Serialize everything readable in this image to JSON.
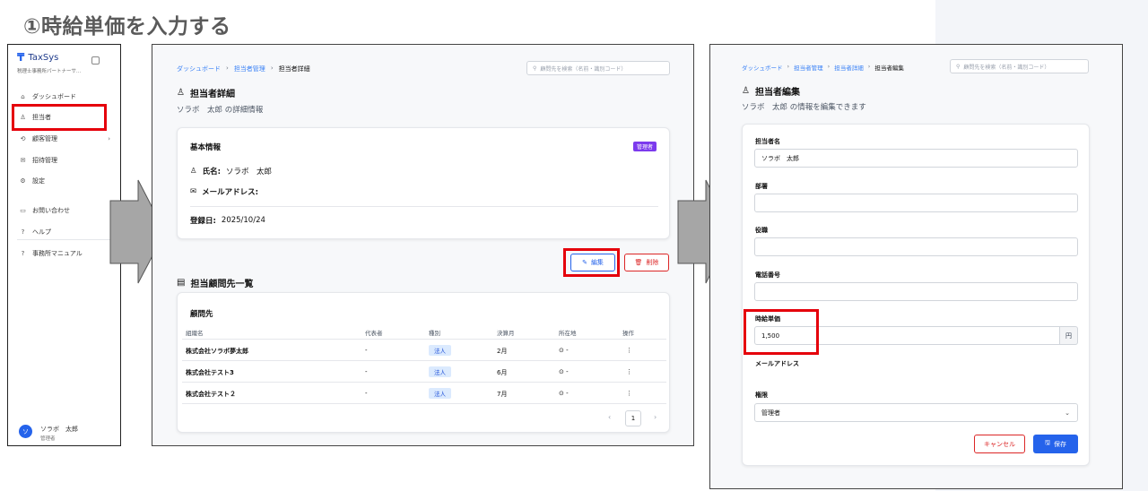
{
  "step_title": "①時給単価を入力する",
  "sidebar": {
    "app_name": "TaxSys",
    "app_sub": "税理士事務所パートナーサ…",
    "items": [
      {
        "label": "ダッシュボード",
        "icon": "home-icon"
      },
      {
        "label": "担当者",
        "icon": "user-icon"
      },
      {
        "label": "顧客管理",
        "icon": "clients-icon",
        "chevron": "›"
      },
      {
        "label": "招待管理",
        "icon": "mail-icon"
      },
      {
        "label": "設定",
        "icon": "gear-icon"
      },
      {
        "label": "お問い合わせ",
        "icon": "message-icon"
      },
      {
        "label": "ヘルプ",
        "icon": "help-icon"
      },
      {
        "label": "事務所マニュアル",
        "icon": "manual-icon"
      }
    ],
    "user": {
      "initial": "ソ",
      "name": "ソラボ　太郎",
      "role": "管理者"
    }
  },
  "detail": {
    "breadcrumb": {
      "b1": "ダッシュボード",
      "b2": "担当者管理",
      "b3": "担当者詳細",
      "sep": "›"
    },
    "search_placeholder": "顧問先を検索（名前・識別コード）",
    "title": "担当者詳細",
    "subtitle": "ソラボ　太郎 の詳細情報",
    "basic_title": "基本情報",
    "admin_badge": "管理者",
    "name_label": "氏名:",
    "name_value": "ソラボ　太郎",
    "email_label": "メールアドレス:",
    "reg_label": "登録日:",
    "reg_value": "2025/10/24",
    "edit_label": "編集",
    "delete_label": "削除",
    "clients_title": "担当顧問先一覧",
    "table_title": "顧問先",
    "headers": {
      "org": "組織名",
      "rep": "代表者",
      "type": "種別",
      "month": "決算月",
      "loc": "所在地",
      "action": "操作"
    },
    "rows": [
      {
        "org": "株式会社ソラボ夢太郎",
        "rep": "-",
        "type": "法人",
        "month": "2月",
        "loc": "-",
        "action": "⋮"
      },
      {
        "org": "株式会社テスト3",
        "rep": "-",
        "type": "法人",
        "month": "6月",
        "loc": "-",
        "action": "⋮"
      },
      {
        "org": "株式会社テスト２",
        "rep": "-",
        "type": "法人",
        "month": "7月",
        "loc": "-",
        "action": "⋮"
      }
    ],
    "pager": {
      "prev": "‹",
      "page": "1",
      "next": "›"
    }
  },
  "edit": {
    "breadcrumb": {
      "b1": "ダッシュボード",
      "b2": "担当者管理",
      "b3": "担当者詳細",
      "b4": "担当者編集",
      "sep": "›"
    },
    "search_placeholder": "顧問先を検索（名前・識別コード）",
    "title": "担当者編集",
    "subtitle": "ソラボ　太郎 の情報を編集できます",
    "fields": {
      "name_label": "担当者名",
      "name_value": "ソラボ　太郎",
      "dept_label": "部署",
      "dept_value": "",
      "pos_label": "役職",
      "pos_value": "",
      "phone_label": "電話番号",
      "phone_value": "",
      "wage_label": "時給単価",
      "wage_value": "1,500",
      "wage_unit": "円",
      "email_label": "メールアドレス",
      "role_label": "権限",
      "role_value": "管理者"
    },
    "cancel_label": "キャンセル",
    "save_label": "保存"
  },
  "colors": {
    "highlight": "#e5000b",
    "primary": "#2563eb",
    "danger": "#dc2626",
    "admin_badge": "#7c3aed"
  }
}
